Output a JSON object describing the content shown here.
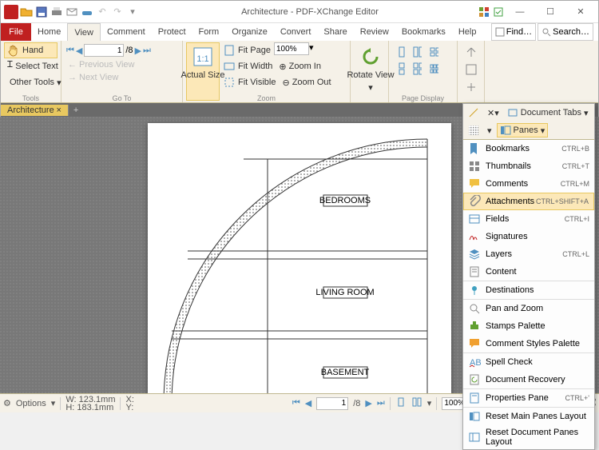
{
  "title": "Architecture - PDF-XChange Editor",
  "find_label": "Find…",
  "search_label": "Search…",
  "tabs": {
    "file": "File",
    "home": "Home",
    "view": "View",
    "comment": "Comment",
    "protect": "Protect",
    "form": "Form",
    "organize": "Organize",
    "convert": "Convert",
    "share": "Share",
    "review": "Review",
    "bookmarks": "Bookmarks",
    "help": "Help"
  },
  "ribbon": {
    "tools": {
      "hand": "Hand",
      "select_text": "Select Text",
      "other_tools": "Other Tools",
      "label": "Tools"
    },
    "goto": {
      "prev": "Previous View",
      "next": "Next View",
      "page": "1",
      "total": "/8",
      "label": "Go To"
    },
    "zoom": {
      "actual": "Actual Size",
      "fit_page": "Fit Page",
      "fit_width": "Fit Width",
      "fit_visible": "Fit Visible",
      "zoom_in": "Zoom In",
      "zoom_out": "Zoom Out",
      "value": "100%",
      "label": "Zoom"
    },
    "rotate": {
      "label_btn": "Rotate View",
      "label": "Page Display"
    },
    "doctabs": {
      "label": "Document Tabs"
    },
    "panes": {
      "label": "Panes"
    }
  },
  "doc_tab": "Architecture",
  "panes_menu": [
    {
      "icon": "bookmark",
      "label": "Bookmarks",
      "shortcut": "CTRL+B"
    },
    {
      "icon": "thumbs",
      "label": "Thumbnails",
      "shortcut": "CTRL+T"
    },
    {
      "icon": "comment",
      "label": "Comments",
      "shortcut": "CTRL+M"
    },
    {
      "icon": "attach",
      "label": "Attachments",
      "shortcut": "CTRL+SHIFT+A",
      "highlight": true
    },
    {
      "icon": "fields",
      "label": "Fields",
      "shortcut": "CTRL+I"
    },
    {
      "icon": "sig",
      "label": "Signatures"
    },
    {
      "icon": "layers",
      "label": "Layers",
      "shortcut": "CTRL+L"
    },
    {
      "icon": "content",
      "label": "Content"
    },
    {
      "icon": "dest",
      "label": "Destinations",
      "sep": true
    },
    {
      "icon": "panzoom",
      "label": "Pan and Zoom",
      "sep": true
    },
    {
      "icon": "stamps",
      "label": "Stamps Palette"
    },
    {
      "icon": "cstyles",
      "label": "Comment Styles Palette"
    },
    {
      "icon": "spell",
      "label": "Spell Check",
      "sep": true
    },
    {
      "icon": "recover",
      "label": "Document Recovery"
    },
    {
      "icon": "props",
      "label": "Properties Pane",
      "shortcut": "CTRL+'",
      "sep": true
    },
    {
      "icon": "reset1",
      "label": "Reset Main Panes Layout",
      "sep": true
    },
    {
      "icon": "reset2",
      "label": "Reset Document Panes Layout"
    }
  ],
  "status": {
    "options": "Options",
    "w": "W: 123.1mm",
    "h": "H: 183.1mm",
    "x": "X:",
    "y": "Y:",
    "page": "1",
    "total": "/8",
    "zoom": "100%"
  },
  "drawing_labels": {
    "bedrooms": "BEDROOMS",
    "living": "LIVING ROOM",
    "basement": "BASEMENT"
  }
}
